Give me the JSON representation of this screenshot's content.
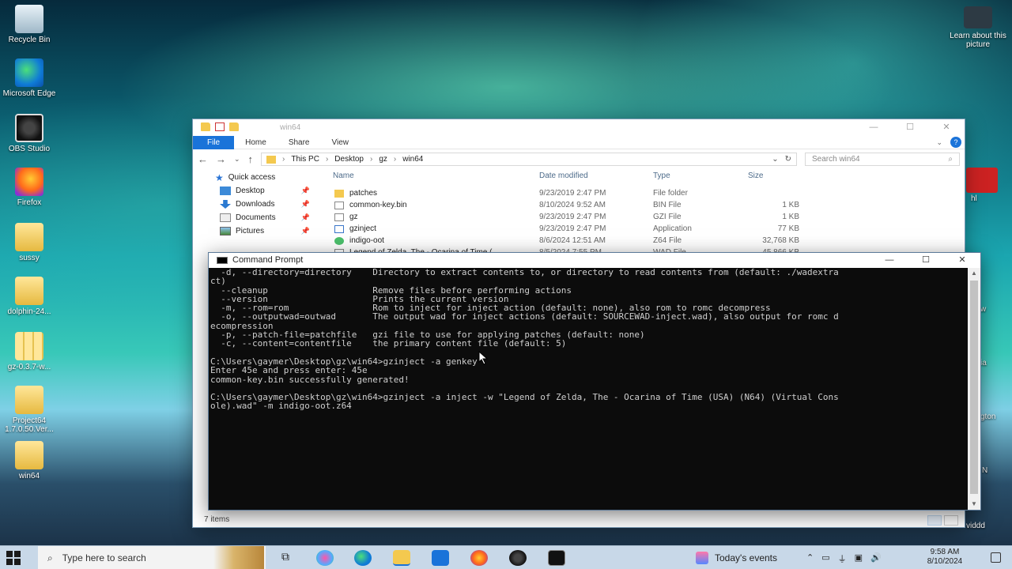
{
  "desktop": {
    "icons_left": [
      {
        "label": "Recycle Bin",
        "icon": "recycle-bin-icon"
      },
      {
        "label": "Microsoft Edge",
        "icon": "edge-icon"
      },
      {
        "label": "OBS Studio",
        "icon": "obs-icon"
      },
      {
        "label": "Firefox",
        "icon": "firefox-icon"
      },
      {
        "label": "sussy",
        "icon": "folder-icon"
      },
      {
        "label": "dolphin-24...",
        "icon": "folder-icon"
      },
      {
        "label": "gz-0.3.7-w...",
        "icon": "zip-icon"
      },
      {
        "label": "Project64 1.7.0.50.Ver...",
        "icon": "folder-icon"
      },
      {
        "label": "win64",
        "icon": "folder-icon"
      }
    ],
    "learn": "Learn about this picture",
    "right_icons": [
      {
        "label": "hl"
      },
      {
        "label": "w"
      },
      {
        "label": "ia"
      },
      {
        "label": "gton"
      },
      {
        "label": "N"
      },
      {
        "label": "viddd"
      }
    ]
  },
  "explorer": {
    "title": "win64",
    "ribbon_tabs": [
      "File",
      "Home",
      "Share",
      "View"
    ],
    "breadcrumb": [
      "This PC",
      "Desktop",
      "gz",
      "win64"
    ],
    "search_placeholder": "Search win64",
    "nav": {
      "quick_access": "Quick access",
      "items": [
        "Desktop",
        "Downloads",
        "Documents",
        "Pictures"
      ]
    },
    "columns": [
      "Name",
      "Date modified",
      "Type",
      "Size"
    ],
    "files": [
      {
        "name": "patches",
        "date": "9/23/2019 2:47 PM",
        "type": "File folder",
        "size": "",
        "kind": "folder"
      },
      {
        "name": "common-key.bin",
        "date": "8/10/2024 9:52 AM",
        "type": "BIN File",
        "size": "1 KB",
        "kind": "file"
      },
      {
        "name": "gz",
        "date": "9/23/2019 2:47 PM",
        "type": "GZI File",
        "size": "1 KB",
        "kind": "file"
      },
      {
        "name": "gzinject",
        "date": "9/23/2019 2:47 PM",
        "type": "Application",
        "size": "77 KB",
        "kind": "app"
      },
      {
        "name": "indigo-oot",
        "date": "8/6/2024 12:51 AM",
        "type": "Z64 File",
        "size": "32,768 KB",
        "kind": "oot"
      },
      {
        "name": "Legend of Zelda, The - Ocarina of Time (...",
        "date": "8/5/2024 7:55 PM",
        "type": "WAD File",
        "size": "45,866 KB",
        "kind": "file"
      }
    ],
    "status": "7 items"
  },
  "cmd": {
    "title": "Command Prompt",
    "lines": [
      "  -d, --directory=directory    Directory to extract contents to, or directory to read contents from (default: ./wadextra",
      "ct)",
      "  --cleanup                    Remove files before performing actions",
      "  --version                    Prints the current version",
      "  -m, --rom=rom                Rom to inject for inject action (default: none), also rom to romc decompress",
      "  -o, --outputwad=outwad       The output wad for inject actions (default: SOURCEWAD-inject.wad), also output for romc d",
      "ecompression",
      "  -p, --patch-file=patchfile   gzi file to use for applying patches (default: none)",
      "  -c, --content=contentfile    the primary content file (default: 5)",
      "",
      "C:\\Users\\gaymer\\Desktop\\gz\\win64>gzinject -a genkey",
      "Enter 45e and press enter: 45e",
      "common-key.bin successfully generated!",
      "",
      "C:\\Users\\gaymer\\Desktop\\gz\\win64>gzinject -a inject -w \"Legend of Zelda, The - Ocarina of Time (USA) (N64) (Virtual Cons",
      "ole).wad\" -m indigo-oot.z64"
    ]
  },
  "taskbar": {
    "search_placeholder": "Type here to search",
    "weather": "Today's events",
    "time": "9:58 AM",
    "date": "8/10/2024"
  }
}
